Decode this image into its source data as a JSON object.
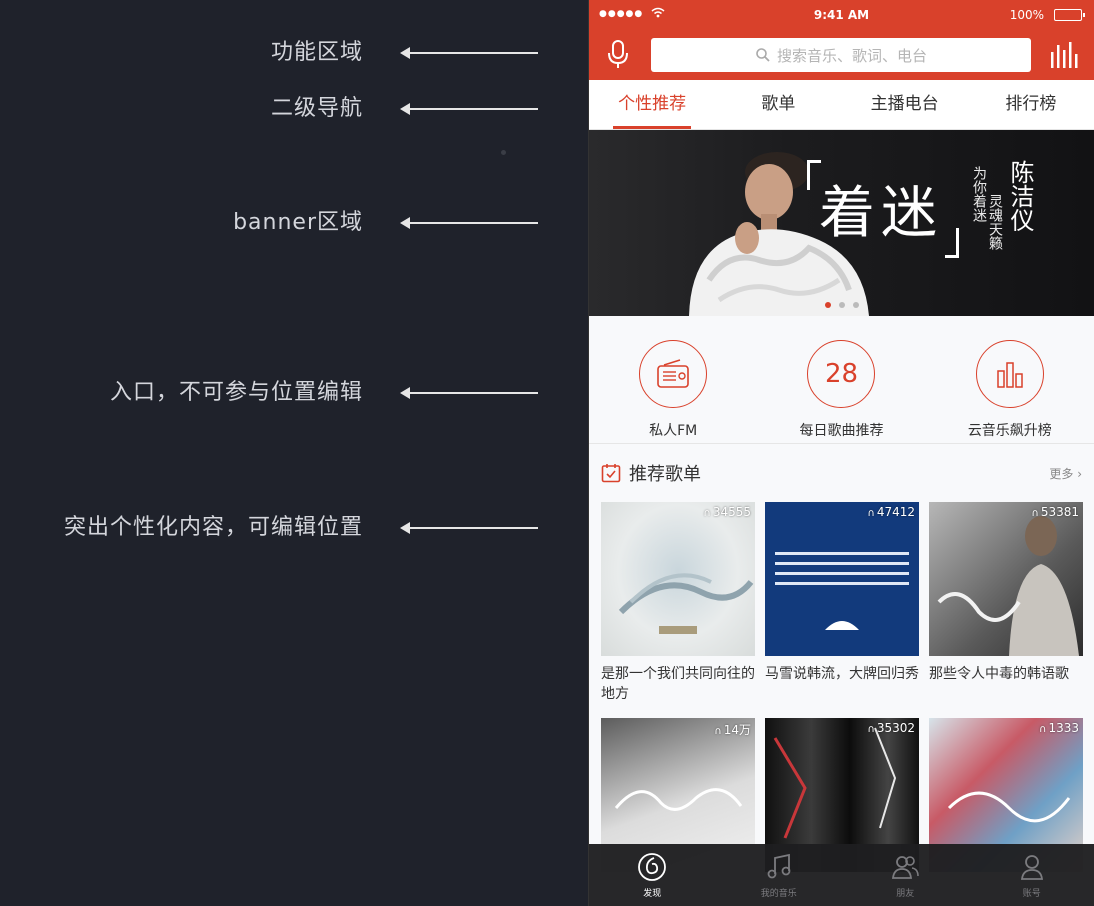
{
  "annotations": [
    {
      "label": "功能区域"
    },
    {
      "label": "二级导航"
    },
    {
      "label": "banner区域"
    },
    {
      "label": "入口，不可参与位置编辑"
    },
    {
      "label": "突出个性化内容，可编辑位置"
    }
  ],
  "status_bar": {
    "signal": "●●●●●",
    "time": "9:41 AM",
    "battery": "100%"
  },
  "search": {
    "placeholder": "搜索音乐、歌词、电台"
  },
  "tabs": [
    {
      "label": "个性推荐",
      "active": true
    },
    {
      "label": "歌单",
      "active": false
    },
    {
      "label": "主播电台",
      "active": false
    },
    {
      "label": "排行榜",
      "active": false
    }
  ],
  "banner": {
    "title": "着迷",
    "sub1": "为你着迷",
    "sub2": "灵魂天籁",
    "artist": "陈洁仪",
    "active_dot": 0,
    "dots": 3
  },
  "entries": [
    {
      "label": "私人FM",
      "icon": "radio-icon"
    },
    {
      "label": "每日歌曲推荐",
      "icon": "calendar-icon",
      "number": "28"
    },
    {
      "label": "云音乐飙升榜",
      "icon": "chart-bars-icon"
    }
  ],
  "section": {
    "title": "推荐歌单",
    "more": "更多"
  },
  "playlists": [
    {
      "plays": "34555",
      "name": "是那一个我们共同向往的地方"
    },
    {
      "plays": "47412",
      "name": "马雪说韩流，大牌回归秀"
    },
    {
      "plays": "53381",
      "name": "那些令人中毒的韩语歌"
    },
    {
      "plays": "14万",
      "name": ""
    },
    {
      "plays": "35302",
      "name": ""
    },
    {
      "plays": "1333",
      "name": ""
    }
  ],
  "bottom_nav": [
    {
      "label": "发现",
      "active": true
    },
    {
      "label": "我的音乐",
      "active": false
    },
    {
      "label": "朋友",
      "active": false
    },
    {
      "label": "账号",
      "active": false
    }
  ],
  "colors": {
    "accent": "#d9412b",
    "background": "#1f222b"
  }
}
